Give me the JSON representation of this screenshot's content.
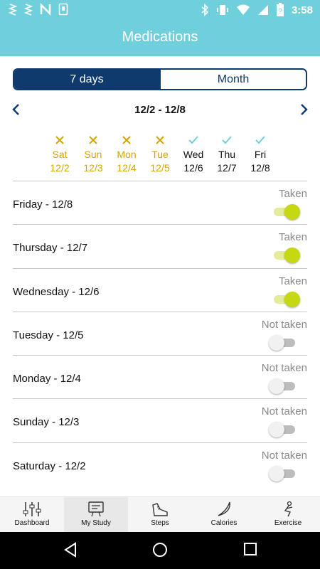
{
  "status_bar": {
    "time": "3:58",
    "left_icons": [
      "signal-icon",
      "signal-icon",
      "n-icon",
      "sim-icon"
    ],
    "right_icons": [
      "bluetooth-icon",
      "vibrate-icon",
      "wifi-icon",
      "no-sim-icon",
      "battery-icon"
    ]
  },
  "app_bar": {
    "title": "Medications"
  },
  "segment": {
    "tabs": [
      {
        "label": "7 days",
        "active": true
      },
      {
        "label": "Month",
        "active": false
      }
    ]
  },
  "range": {
    "label": "12/2 - 12/8"
  },
  "week": {
    "days": [
      {
        "name": "Sat",
        "date": "12/2",
        "taken": false
      },
      {
        "name": "Sun",
        "date": "12/3",
        "taken": false
      },
      {
        "name": "Mon",
        "date": "12/4",
        "taken": false
      },
      {
        "name": "Tue",
        "date": "12/5",
        "taken": false
      },
      {
        "name": "Wed",
        "date": "12/6",
        "taken": true
      },
      {
        "name": "Thu",
        "date": "12/7",
        "taken": true
      },
      {
        "name": "Fri",
        "date": "12/8",
        "taken": true
      }
    ]
  },
  "entries": [
    {
      "day": "Friday - 12/8",
      "status": "Taken",
      "on": true
    },
    {
      "day": "Thursday - 12/7",
      "status": "Taken",
      "on": true
    },
    {
      "day": "Wednesday - 12/6",
      "status": "Taken",
      "on": true
    },
    {
      "day": "Tuesday - 12/5",
      "status": "Not taken",
      "on": false
    },
    {
      "day": "Monday - 12/4",
      "status": "Not taken",
      "on": false
    },
    {
      "day": "Sunday - 12/3",
      "status": "Not taken",
      "on": false
    },
    {
      "day": "Saturday - 12/2",
      "status": "Not taken",
      "on": false
    }
  ],
  "bottom_nav": {
    "items": [
      {
        "label": "Dashboard",
        "icon": "sliders-icon",
        "active": false
      },
      {
        "label": "My Study",
        "icon": "study-icon",
        "active": true
      },
      {
        "label": "Steps",
        "icon": "shoe-icon",
        "active": false
      },
      {
        "label": "Calories",
        "icon": "banana-icon",
        "active": false
      },
      {
        "label": "Exercise",
        "icon": "exercise-icon",
        "active": false
      }
    ]
  },
  "colors": {
    "app_bar": "#6fd0dc",
    "segment_active": "#0e3a6e",
    "missed": "#d4a500",
    "taken_check": "#6fd0dc",
    "toggle_on": "#c5d812"
  }
}
